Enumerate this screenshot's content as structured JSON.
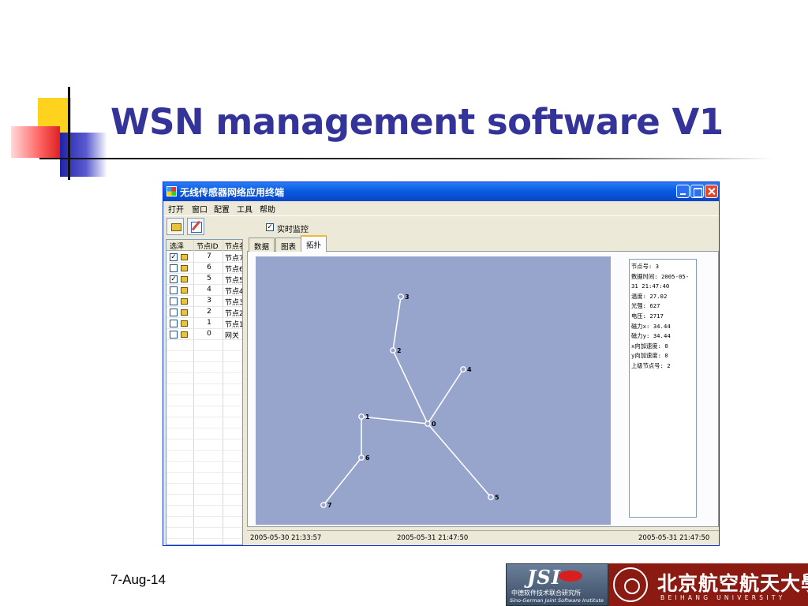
{
  "slide": {
    "title": "WSN management software V1",
    "date": "7-Aug-14"
  },
  "logos": {
    "jsi_mark": "JSI",
    "jsi_cn": "中德软件技术联合研究所",
    "jsi_en": "Sino-German Joint Software Institute",
    "buaa_cn": "北京航空航天大學",
    "buaa_en": "BEIHANG UNIVERSITY"
  },
  "window": {
    "title": "无线传感器网络应用终端",
    "menu": [
      "打开",
      "窗口",
      "配置",
      "工具",
      "帮助"
    ],
    "realtime_label": "实时监控",
    "realtime_checked": true
  },
  "node_list": {
    "columns": [
      "选泽",
      "节点ID",
      "节点名"
    ],
    "rows": [
      {
        "checked": true,
        "id": "7",
        "name": "节点7"
      },
      {
        "checked": false,
        "id": "6",
        "name": "节点6"
      },
      {
        "checked": true,
        "id": "5",
        "name": "节点5"
      },
      {
        "checked": false,
        "id": "4",
        "name": "节点4"
      },
      {
        "checked": false,
        "id": "3",
        "name": "节点3"
      },
      {
        "checked": false,
        "id": "2",
        "name": "节点2"
      },
      {
        "checked": false,
        "id": "1",
        "name": "节点1"
      },
      {
        "checked": false,
        "id": "0",
        "name": "网关"
      }
    ]
  },
  "tabs": [
    "数据",
    "图表",
    "拓扑"
  ],
  "active_tab": "拓扑",
  "topology": {
    "nodes": [
      "0",
      "1",
      "2",
      "3",
      "4",
      "5",
      "6",
      "7"
    ],
    "links": [
      [
        "3",
        "2"
      ],
      [
        "2",
        "0"
      ],
      [
        "4",
        "0"
      ],
      [
        "1",
        "0"
      ],
      [
        "0",
        "5"
      ],
      [
        "1",
        "6"
      ],
      [
        "6",
        "7"
      ]
    ]
  },
  "info": [
    "节点号: 3",
    "数据时间: 2005-05-",
    "31 21:47:40",
    "温度: 27.02",
    "光强: 627",
    "电压: 2717",
    "磁力x: 34.44",
    "磁力y: 34.44",
    "x向加速度: 0",
    "y向加速度: 0",
    "上级节点号: 2"
  ],
  "status": {
    "left": "2005-05-30 21:33:57",
    "center": "2005-05-31 21:47:50",
    "right": "2005-05-31 21:47:50"
  },
  "colors": {
    "title": "#333399",
    "canvas": "#97a4cc",
    "titlebar": "#0a5be0"
  }
}
